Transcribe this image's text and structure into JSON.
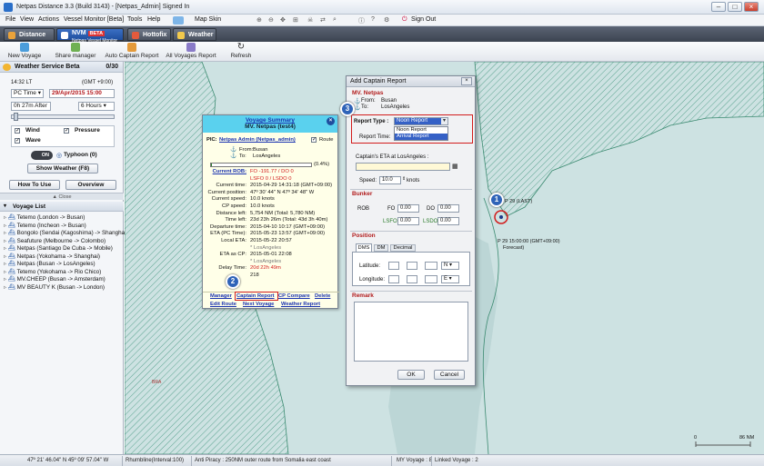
{
  "window": {
    "title": "Netpas Distance 3.3 (Build 3143) - [Netpas_Admin] Signed In"
  },
  "menu": {
    "file": "File",
    "view": "View",
    "actions": "Actions",
    "vessel_monitor": "Vessel Monitor [Beta]",
    "tools": "Tools",
    "help": "Help",
    "map_skin": "Map Skin",
    "sign_out": "Sign Out"
  },
  "tabs": {
    "distance": "Distance",
    "nvm_badge": "NVM",
    "nvm_beta": "BETA",
    "nvm_sub": "Netpas Vessel Monitor",
    "hottofix": "Hottofix",
    "weather": "Weather"
  },
  "toolbar": {
    "new_voyage": "New Voyage",
    "share_manager": "Share manager",
    "auto_captain_report": "Auto Captain Report",
    "all_voyages_report": "All Voyages Report",
    "refresh": "Refresh"
  },
  "weather": {
    "title": "Weather Service Beta",
    "count": "0/30",
    "lt": "14:32 LT",
    "gmt": "(GMT +9:00)",
    "time_mode": "PC Time",
    "date": "29/Apr/2015 15:00",
    "after": "0h 27m After",
    "hours": "6 Hours",
    "wind": "Wind",
    "pressure": "Pressure",
    "wave": "Wave",
    "toggle_on": "ON",
    "typhoon": "Typhoon (0)",
    "show_weather": "Show Weather (F8)",
    "how_to_use": "How To Use",
    "overview": "Overview",
    "close": "Close"
  },
  "voyage_list": {
    "title": "Voyage List",
    "items": [
      "Tetemo (London -> Busan)",
      "Tetemo (Incheon -> Busan)",
      "Bongolo (Sendai (Kagoshima) -> Shanghai",
      "Seafuture (Melbourne -> Colombo)",
      "Netpas (Santiago De Cuba -> Mobile)",
      "Netpas (Yokohama -> Shanghai)",
      "Netpas (Busan -> LosAngeles)",
      "Tetemo (Yokohama -> Rio Chico)",
      "MV.CHEEP (Busan -> Amsterdam)",
      "MV BEAUTY K (Busan -> London)"
    ]
  },
  "status": {
    "coords": "47º 21' 46.04\" N    45º 09' 57.04\" W",
    "rhumb": "Rhumbline(Interval:100)",
    "piracy": "Anti Piracy : 250NM outer route from Somalia east coast",
    "my_voyage": "MY Voyage : 8",
    "linked_voyage": "Linked Voyage : 2"
  },
  "summary": {
    "title": "Voyage Summary",
    "vessel": "MV. Netpas (test4)",
    "pic_label": "PIC:",
    "pic": "Netpas Admin (Netpas_admin)",
    "route": "Route",
    "from_label": "From:",
    "from": "Busan",
    "to_label": "To:",
    "to": "LosAngeles",
    "progress_pct": "(0.4%)",
    "progress": 0.004,
    "rows": [
      {
        "k": "Current ROB:",
        "v": "FO -191.77 / DO 0"
      },
      {
        "k": "",
        "v": "LSFO 0 / LSDO 0"
      },
      {
        "k": "Current time:",
        "v": "2015-04-29 14:31:18 (GMT+09:00)"
      },
      {
        "k": "Current position:",
        "v": "47º 30' 44\" N  47º 34' 48\" W"
      },
      {
        "k": "Current speed:",
        "v": "10.0 knots"
      },
      {
        "k": "CP speed:",
        "v": "10.0 knots"
      },
      {
        "k": "Distance left:",
        "v": "5,754 NM (Total: 5,780 NM)"
      },
      {
        "k": "Time left:",
        "v": "23d 23h 26m (Total: 43d 3h 40m)"
      },
      {
        "k": "Departure time:",
        "v": "2015-04-10 10:17 (GMT+09:00)"
      },
      {
        "k": "ETA (PC Time):",
        "v": "2015-05-23 13:57 (GMT+09:00)"
      },
      {
        "k": "Local ETA:",
        "v": "2015-05-22 20:57"
      },
      {
        "k": "",
        "v": "* LosAngeles"
      },
      {
        "k": "ETA as CP:",
        "v": "2015-05-01 22:08"
      },
      {
        "k": "",
        "v": "* LosAngeles"
      },
      {
        "k": "Delay Time:",
        "v": "20d 22h 49m"
      },
      {
        "k": "",
        "v": "218"
      }
    ],
    "links": {
      "manager": "Manager",
      "captain_report": "Captain Report",
      "cp_compare": "CP Compare",
      "delete": "Delete",
      "edit_route": "Edit Route",
      "next_voyage": "Next Voyage",
      "weather_report": "Weather Report"
    }
  },
  "captain": {
    "title": "Add Captain Report",
    "vessel": "MV. Netpas",
    "from_label": "From:",
    "from": "Busan",
    "to_label": "To:",
    "to": "LosAngeles",
    "report_type_label": "Report Type :",
    "report_type": "Noon Report",
    "options": [
      "Noon Report",
      "Arrival Report"
    ],
    "report_time_label": "Report Time:",
    "eta_label": "Captain's ETA at LosAngeles :",
    "speed_label": "Speed:",
    "speed": "10.0",
    "knots": "knots",
    "bunker": "Bunker",
    "rob": "ROB",
    "fo": "FO",
    "fo_v": "0.00",
    "do": "DO",
    "do_v": "0.00",
    "lsfo": "LSFO",
    "lsfo_v": "0.00",
    "lsdo": "LSDO",
    "lsdo_v": "0.00",
    "position": "Position",
    "tab_dms": "DMS",
    "tab_dm": "DM",
    "tab_decimal": "Decimal",
    "latitude": "Latitude:",
    "longitude": "Longitude:",
    "lat_dir": "N",
    "lon_dir": "E",
    "remark": "Remark",
    "ok": "OK",
    "cancel": "Cancel"
  },
  "map": {
    "last": "P 29 (LAST)",
    "forecast": "P 29 15:00:00 (GMT+09:00)",
    "forecast2": "Forecast)",
    "scale_0": "0",
    "scale_1": "86 NM",
    "bra": "BRA"
  },
  "badges": [
    "1",
    "2",
    "3"
  ]
}
